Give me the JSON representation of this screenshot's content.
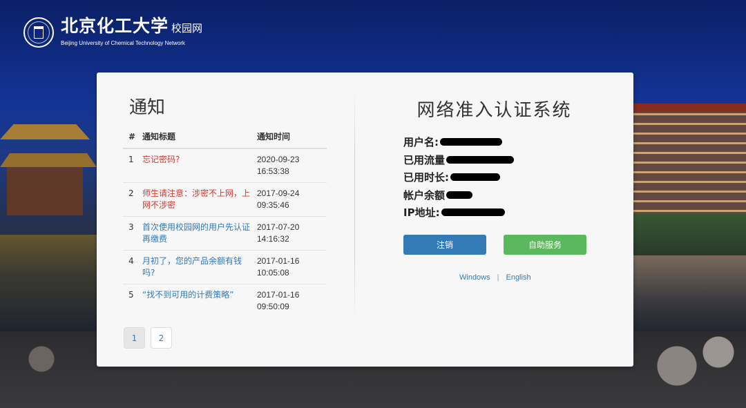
{
  "header": {
    "school_name_cn": "北京化工大学",
    "site_name_cn": "校园网",
    "school_name_en": "Beijing University of Chemical Technology Network"
  },
  "notices": {
    "title": "通知",
    "columns": [
      "#",
      "通知标题",
      "通知时间"
    ],
    "rows": [
      {
        "num": "1",
        "title": "忘记密码?",
        "date": "2020-09-23",
        "time": "16:53:38",
        "color": "#d9362b"
      },
      {
        "num": "2",
        "title": "师生请注意：涉密不上网，上网不涉密",
        "date": "2017-09-24",
        "time": "09:35:46",
        "color": "#d9362b"
      },
      {
        "num": "3",
        "title": "首次使用校园网的用户先认证再缴费",
        "date": "2017-07-20",
        "time": "14:16:32",
        "color": "#337ab7"
      },
      {
        "num": "4",
        "title": "月初了，您的产品余额有钱吗?",
        "date": "2017-01-16",
        "time": "10:05:08",
        "color": "#337ab7"
      },
      {
        "num": "5",
        "title": "“找不到可用的计费策略”",
        "date": "2017-01-16",
        "time": "09:50:09",
        "color": "#337ab7"
      }
    ],
    "pages": [
      "1",
      "2"
    ],
    "active_page": "1"
  },
  "system": {
    "title": "网络准入认证系统",
    "fields": [
      {
        "label": "用户名:",
        "value_redacted": true
      },
      {
        "label": "已用流量",
        "value_redacted": true
      },
      {
        "label": "已用时长:",
        "value_redacted": true
      },
      {
        "label": "帐户余额",
        "value_redacted": true
      },
      {
        "label": "IP地址:",
        "value_redacted": true
      }
    ],
    "logout_label": "注销",
    "self_service_label": "自助服务",
    "links": [
      "Windows",
      "English"
    ],
    "link_separator": "|"
  },
  "colors": {
    "primary": "#337ab7",
    "success": "#5cb85c",
    "alert": "#d9362b"
  }
}
